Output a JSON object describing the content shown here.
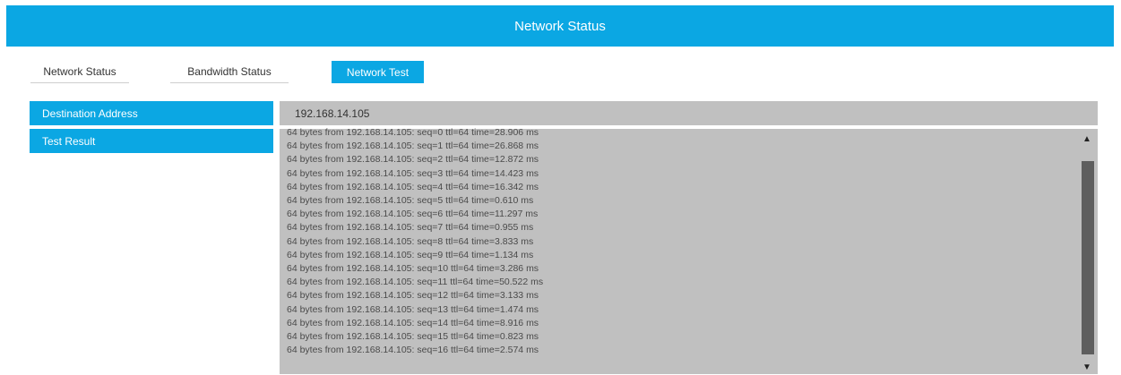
{
  "header": {
    "title": "Network Status"
  },
  "tabs": [
    {
      "label": "Network Status",
      "active": false
    },
    {
      "label": "Bandwidth Status",
      "active": false
    },
    {
      "label": "Network Test",
      "active": true
    }
  ],
  "form": {
    "destination_label": "Destination Address",
    "destination_value": "192.168.14.105",
    "result_label": "Test Result"
  },
  "results": [
    "64 bytes from 192.168.14.105: seq=0 ttl=64 time=28.906 ms",
    "64 bytes from 192.168.14.105: seq=1 ttl=64 time=26.868 ms",
    "64 bytes from 192.168.14.105: seq=2 ttl=64 time=12.872 ms",
    "64 bytes from 192.168.14.105: seq=3 ttl=64 time=14.423 ms",
    "64 bytes from 192.168.14.105: seq=4 ttl=64 time=16.342 ms",
    "64 bytes from 192.168.14.105: seq=5 ttl=64 time=0.610 ms",
    "64 bytes from 192.168.14.105: seq=6 ttl=64 time=11.297 ms",
    "64 bytes from 192.168.14.105: seq=7 ttl=64 time=0.955 ms",
    "64 bytes from 192.168.14.105: seq=8 ttl=64 time=3.833 ms",
    "64 bytes from 192.168.14.105: seq=9 ttl=64 time=1.134 ms",
    "64 bytes from 192.168.14.105: seq=10 ttl=64 time=3.286 ms",
    "64 bytes from 192.168.14.105: seq=11 ttl=64 time=50.522 ms",
    "64 bytes from 192.168.14.105: seq=12 ttl=64 time=3.133 ms",
    "64 bytes from 192.168.14.105: seq=13 ttl=64 time=1.474 ms",
    "64 bytes from 192.168.14.105: seq=14 ttl=64 time=8.916 ms",
    "64 bytes from 192.168.14.105: seq=15 ttl=64 time=0.823 ms",
    "64 bytes from 192.168.14.105: seq=16 ttl=64 time=2.574 ms"
  ],
  "scrollbar": {
    "up_icon": "triangle-up",
    "down_icon": "triangle-down"
  },
  "colors": {
    "accent": "#0ba7e3",
    "panel": "#c0c0c0",
    "thumb": "#5e5e5e"
  }
}
